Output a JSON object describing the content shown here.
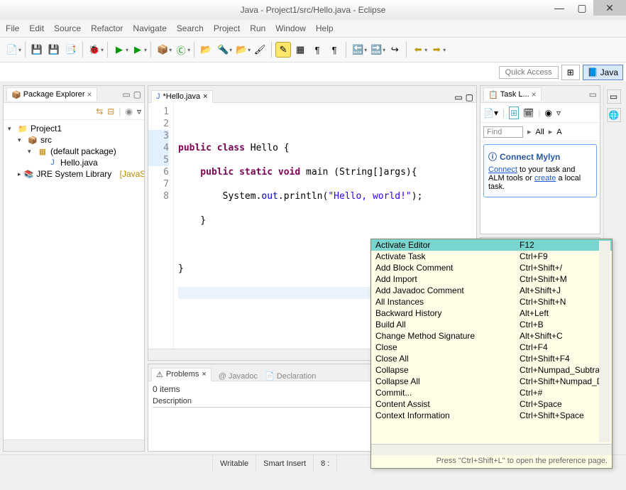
{
  "window": {
    "title": "Java - Project1/src/Hello.java - Eclipse"
  },
  "menu": [
    "File",
    "Edit",
    "Source",
    "Refactor",
    "Navigate",
    "Search",
    "Project",
    "Run",
    "Window",
    "Help"
  ],
  "quick_access": "Quick Access",
  "perspective_label": "Java",
  "package_explorer": {
    "title": "Package Explorer",
    "tree": {
      "project": "Project1",
      "src": "src",
      "pkg": "(default package)",
      "file": "Hello.java",
      "jre": "JRE System Library",
      "jre_suffix": "[JavaSE"
    }
  },
  "editor": {
    "tab": "*Hello.java",
    "lines": [
      "1",
      "2",
      "3",
      "4",
      "5",
      "6",
      "7",
      "8"
    ],
    "code": {
      "l2a": "public",
      "l2b": " class",
      "l2c": " Hello {",
      "l3a": "    public",
      "l3b": " static",
      "l3c": " void",
      "l3d": " main (String[]args){",
      "l4a": "        System.",
      "l4b": "out",
      "l4c": ".println(",
      "l4d": "\"Hello, world!\"",
      "l4e": ");",
      "l5": "    }",
      "l6": "",
      "l7": "}"
    }
  },
  "problems": {
    "tab": "Problems",
    "javadoc": "Javadoc",
    "decl": "Declaration",
    "count": "0 items",
    "col1": "Description"
  },
  "tasklist": {
    "title": "Task L...",
    "find": "Find",
    "all": "All",
    "a": "A"
  },
  "mylyn": {
    "title": "Connect Mylyn",
    "connect": "Connect",
    "text1": " to your task and ALM tools or ",
    "create": "create",
    "text2": " a local task."
  },
  "popup": {
    "items": [
      {
        "name": "Activate Editor",
        "key": "F12",
        "sel": true
      },
      {
        "name": "Activate Task",
        "key": "Ctrl+F9"
      },
      {
        "name": "Add Block Comment",
        "key": "Ctrl+Shift+/"
      },
      {
        "name": "Add Import",
        "key": "Ctrl+Shift+M"
      },
      {
        "name": "Add Javadoc Comment",
        "key": "Alt+Shift+J"
      },
      {
        "name": "All Instances",
        "key": "Ctrl+Shift+N"
      },
      {
        "name": "Backward History",
        "key": "Alt+Left"
      },
      {
        "name": "Build All",
        "key": "Ctrl+B"
      },
      {
        "name": "Change Method Signature",
        "key": "Alt+Shift+C"
      },
      {
        "name": "Close",
        "key": "Ctrl+F4"
      },
      {
        "name": "Close All",
        "key": "Ctrl+Shift+F4"
      },
      {
        "name": "Collapse",
        "key": "Ctrl+Numpad_Subtrac"
      },
      {
        "name": "Collapse All",
        "key": "Ctrl+Shift+Numpad_D"
      },
      {
        "name": "Commit...",
        "key": "Ctrl+#"
      },
      {
        "name": "Content Assist",
        "key": "Ctrl+Space"
      },
      {
        "name": "Context Information",
        "key": "Ctrl+Shift+Space"
      }
    ],
    "hint": "Press \"Ctrl+Shift+L\" to open the preference page."
  },
  "status": {
    "writable": "Writable",
    "insert": "Smart Insert",
    "pos": "8 :"
  }
}
